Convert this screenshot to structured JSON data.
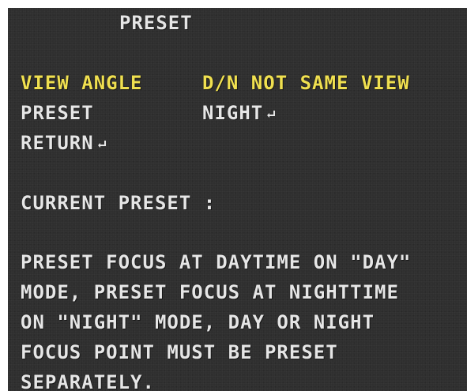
{
  "menu": {
    "title": "PRESET",
    "rows": [
      {
        "label": "VIEW ANGLE",
        "value": "D/N NOT SAME VIEW",
        "highlighted": true
      },
      {
        "label": "PRESET",
        "value": "NIGHT",
        "value_icon": "enter-arrow-icon",
        "highlighted": false
      },
      {
        "label": "RETURN",
        "label_icon": "enter-arrow-icon",
        "highlighted": false
      }
    ],
    "current_preset_label": "CURRENT PRESET :",
    "info_lines": [
      "PRESET FOCUS AT DAYTIME ON \"DAY\"",
      "MODE, PRESET FOCUS AT NIGHTTIME",
      "ON \"NIGHT\" MODE, DAY OR NIGHT",
      "FOCUS POINT MUST BE PRESET",
      "SEPARATELY."
    ]
  },
  "colors": {
    "background": "#2f2f2f",
    "text": "#e6e6e6",
    "highlight": "#f0e050"
  }
}
